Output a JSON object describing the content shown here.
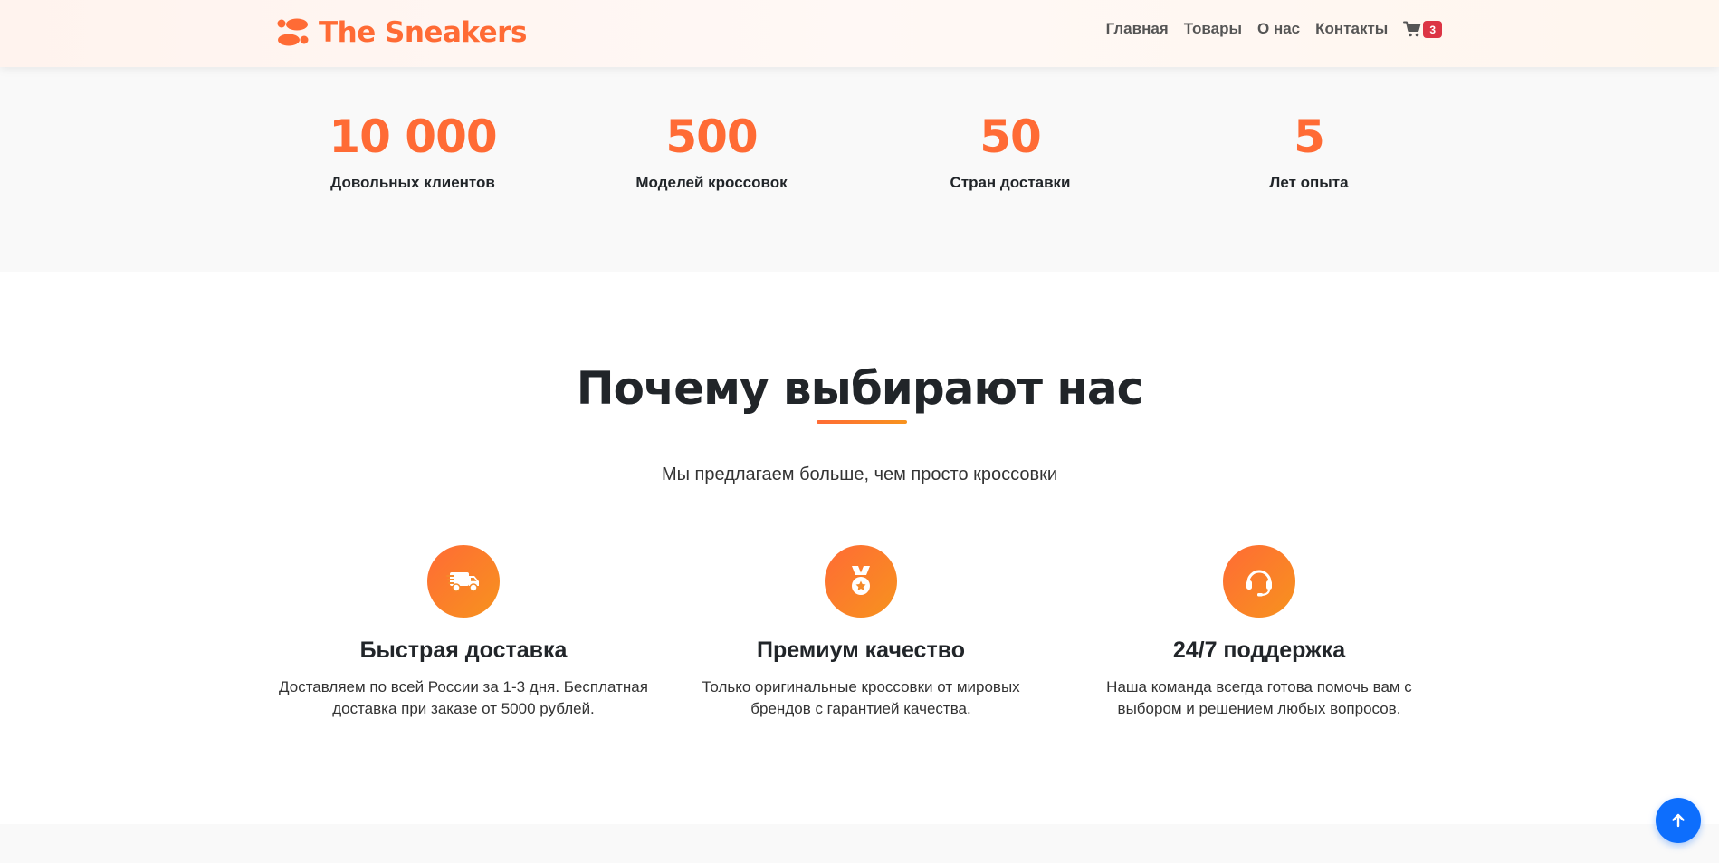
{
  "navbar": {
    "brand": "The Sneakers",
    "brand_icon": "shoe-prints-icon",
    "brand_color": "#ff6b35",
    "links": [
      {
        "label": "Главная"
      },
      {
        "label": "Товары"
      },
      {
        "label": "О нас"
      },
      {
        "label": "Контакты"
      }
    ],
    "cart": {
      "icon": "cart-icon",
      "count": "3",
      "badge_color": "#dc3545"
    }
  },
  "stats": [
    {
      "value": "10 000",
      "label": "Довольных клиентов"
    },
    {
      "value": "500",
      "label": "Моделей кроссовок"
    },
    {
      "value": "50",
      "label": "Стран доставки"
    },
    {
      "value": "5",
      "label": "Лет опыта"
    }
  ],
  "features_section": {
    "title": "Почему выбирают нас",
    "subtitle": "Мы предлагаем больше, чем просто кроссовки",
    "accent_gradient": [
      "#ff6b35",
      "#f7931e"
    ],
    "items": [
      {
        "icon": "truck-icon",
        "title": "Быстрая доставка",
        "text": "Доставляем по всей России за 1-3 дня. Бесплатная доставка при заказе от 5000 рублей."
      },
      {
        "icon": "medal-icon",
        "title": "Премиум качество",
        "text": "Только оригинальные кроссовки от мировых брендов с гарантией качества."
      },
      {
        "icon": "headset-icon",
        "title": "24/7 поддержка",
        "text": "Наша команда всегда готова помочь вам с выбором и решением любых вопросов."
      }
    ]
  },
  "scroll_top": {
    "icon": "arrow-up-icon",
    "color": "#0d6efd"
  }
}
